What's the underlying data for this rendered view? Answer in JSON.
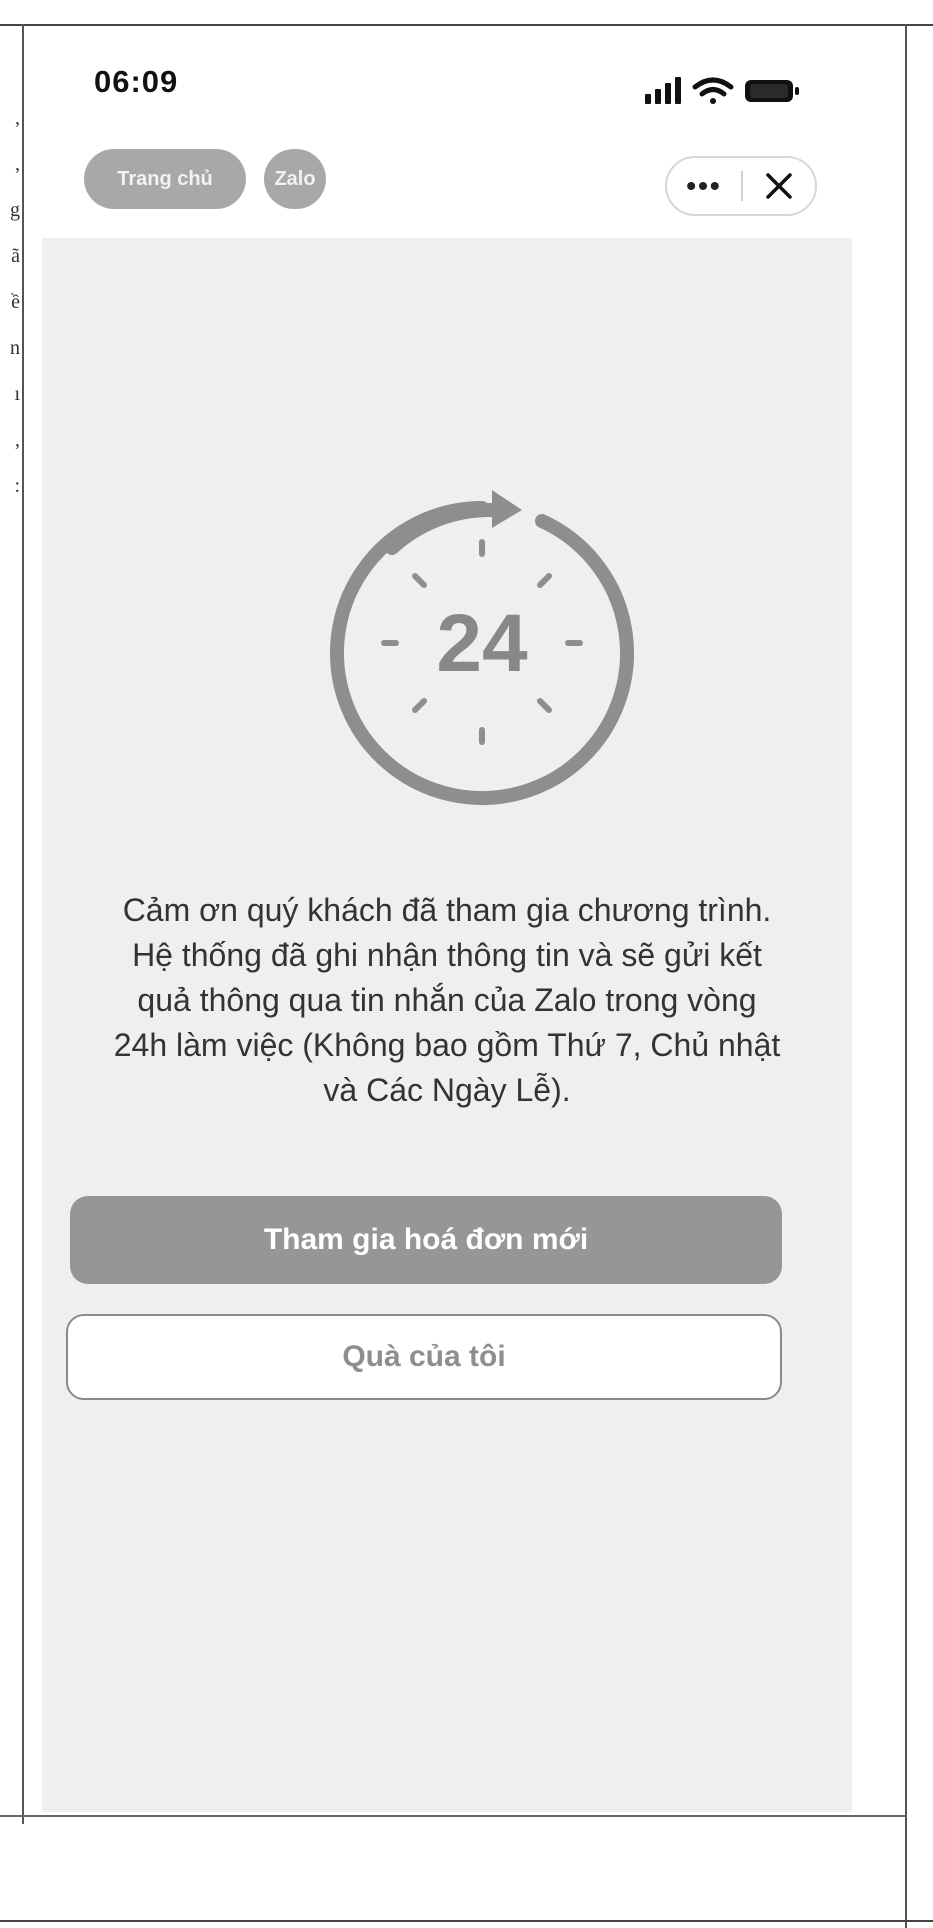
{
  "status_bar": {
    "time": "06:09"
  },
  "header": {
    "home_label": "Trang chủ",
    "zalo_label": "Zalo",
    "more_label": "•••"
  },
  "timer": {
    "number": "24"
  },
  "main": {
    "message": "Cảm ơn quý khách đã tham gia chương trình. Hệ thống đã ghi nhận thông tin và sẽ gửi kết quả thông qua tin nhắn của Zalo trong vòng 24h làm việc (Không bao gồm Thứ 7, Chủ nhật và Các Ngày Lễ).",
    "primary_button": "Tham gia hoá đơn mới",
    "secondary_button": "Quà của tôi"
  },
  "colors": {
    "accent": "#969696",
    "pill": "#a8a8a8",
    "panel": "#efefef"
  }
}
